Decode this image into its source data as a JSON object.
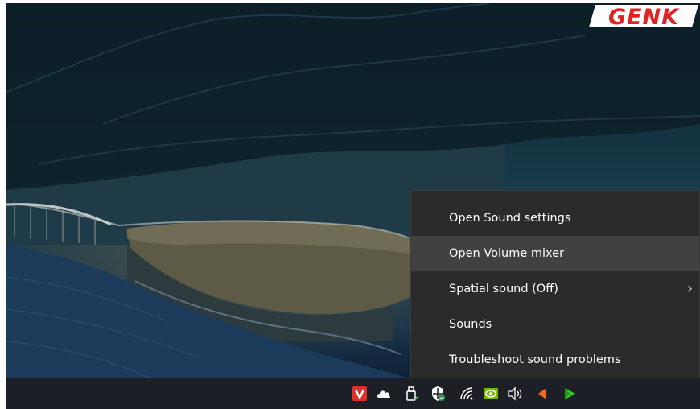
{
  "context_menu": {
    "items": [
      {
        "label": "Open Sound settings",
        "has_submenu": false
      },
      {
        "label": "Open Volume mixer",
        "has_submenu": false,
        "highlighted": true
      },
      {
        "label": "Spatial sound (Off)",
        "has_submenu": true
      },
      {
        "label": "Sounds",
        "has_submenu": false
      },
      {
        "label": "Troubleshoot sound problems",
        "has_submenu": false
      }
    ],
    "submenu_chevron": "›"
  },
  "taskbar": {
    "tray_icons": [
      {
        "name": "vivaldi-icon",
        "color": "#e0302a"
      },
      {
        "name": "cloud-icon",
        "color": "#ffffff"
      },
      {
        "name": "usb-device-icon",
        "color": "#ffffff"
      },
      {
        "name": "windows-security-icon",
        "color": "#ffffff"
      },
      {
        "name": "wifi-icon",
        "color": "#ffffff"
      },
      {
        "name": "nvidia-icon",
        "color": "#76b900"
      },
      {
        "name": "volume-icon",
        "color": "#ffffff"
      },
      {
        "name": "orange-arrow-icon",
        "color": "#f26a1b"
      },
      {
        "name": "green-play-icon",
        "color": "#2bd11d"
      }
    ]
  },
  "brand": {
    "text": "GENK",
    "color": "#e02424"
  }
}
